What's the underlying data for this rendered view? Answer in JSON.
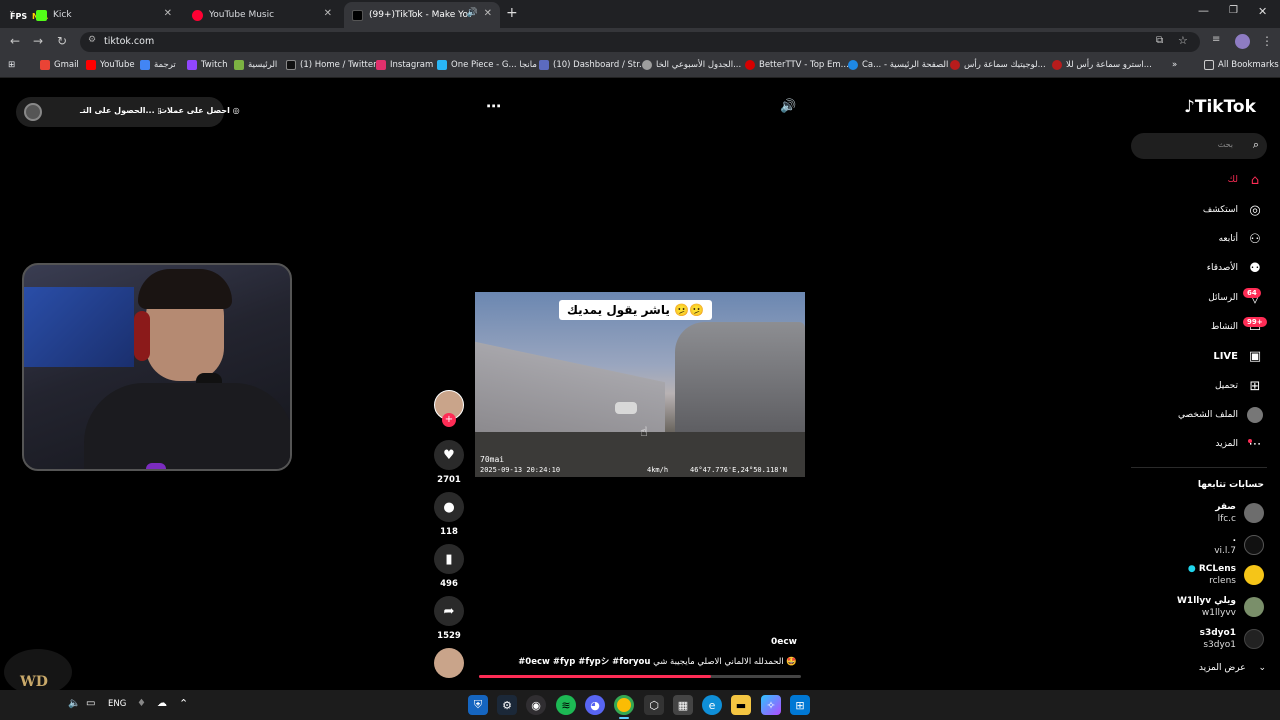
{
  "browser": {
    "tabs": [
      {
        "title": "Kick",
        "active": false
      },
      {
        "title": "YouTube Music",
        "active": false
      },
      {
        "title": "(99+)TikTok - Make Your D",
        "active": true
      }
    ],
    "overlay": {
      "fps_label": "FPS",
      "fps_value": "N/A"
    },
    "url": "tiktok.com",
    "bookmarks": [
      "Gmail",
      "YouTube",
      "ترجمة",
      "Twitch",
      "الرئيسية",
      "(1) Home / Twitter",
      "Instagram",
      "One Piece - G... مانجا",
      "(10) Dashboard / Str...",
      "الجدول الأسبوعي الخا...",
      "BetterTTV - Top Em...",
      "Ca... - الصفحة الرئيسية",
      "لوجيتيك سماعة رأس...",
      "استرو سماعة رأس للا..."
    ],
    "all_bookmarks": "All Bookmarks"
  },
  "tiktok": {
    "logo": "TikTok",
    "top_left": {
      "get_coins": "احصل على عملات",
      "get_app": "الحصول على التـ..."
    },
    "search_placeholder": "بحث",
    "nav": [
      {
        "label": "لك",
        "icon": "home-icon"
      },
      {
        "label": "استكشف",
        "icon": "compass-icon"
      },
      {
        "label": "أتابعه",
        "icon": "following-icon"
      },
      {
        "label": "الأصدقاء",
        "icon": "friends-icon"
      },
      {
        "label": "الرسائل",
        "icon": "messages-icon",
        "badge": "64"
      },
      {
        "label": "النشاط",
        "icon": "activity-icon",
        "badge": "99+"
      },
      {
        "label": "LIVE",
        "icon": "live-icon"
      },
      {
        "label": "تحميل",
        "icon": "upload-icon"
      },
      {
        "label": "الملف الشخصي",
        "icon": "profile-icon"
      },
      {
        "label": "المزيد",
        "icon": "more-icon"
      }
    ],
    "following_title": "حسابات تتابعها",
    "following": [
      {
        "name": "صقر",
        "handle": "lfc.c"
      },
      {
        "name": ".",
        "handle": "vi.l.7"
      },
      {
        "name": "RCLens",
        "handle": "rclens"
      },
      {
        "name": "W1llyv ويلي",
        "handle": "w1llyvv"
      },
      {
        "name": "s3dyo1",
        "handle": "s3dyo1"
      }
    ],
    "show_more": "عرض المزيد",
    "video": {
      "caption_overlay": "ياشر يقول يمديك 🫤🫤",
      "dashcam_brand": "70mai",
      "dashcam_time": "2025-09-13 20:24:10",
      "dashcam_speed": "4km/h",
      "dashcam_coords": "46°47.776'E,24°50.118'N",
      "author": "0ecw",
      "description": "الحمدلله الالماني الاصلي مايجيبة شي 🤩",
      "hashtags": "#0ecw #fyp #fypシ #foryou",
      "progress": 0.72
    },
    "actions": {
      "likes": "2701",
      "comments": "118",
      "saves": "496",
      "shares": "1529"
    }
  },
  "taskbar": {
    "lang": "ENG",
    "stream_logo": "WD"
  },
  "colors": {
    "accent": "#fe2c55",
    "chrome_dark": "#202124",
    "chrome": "#35363a"
  }
}
